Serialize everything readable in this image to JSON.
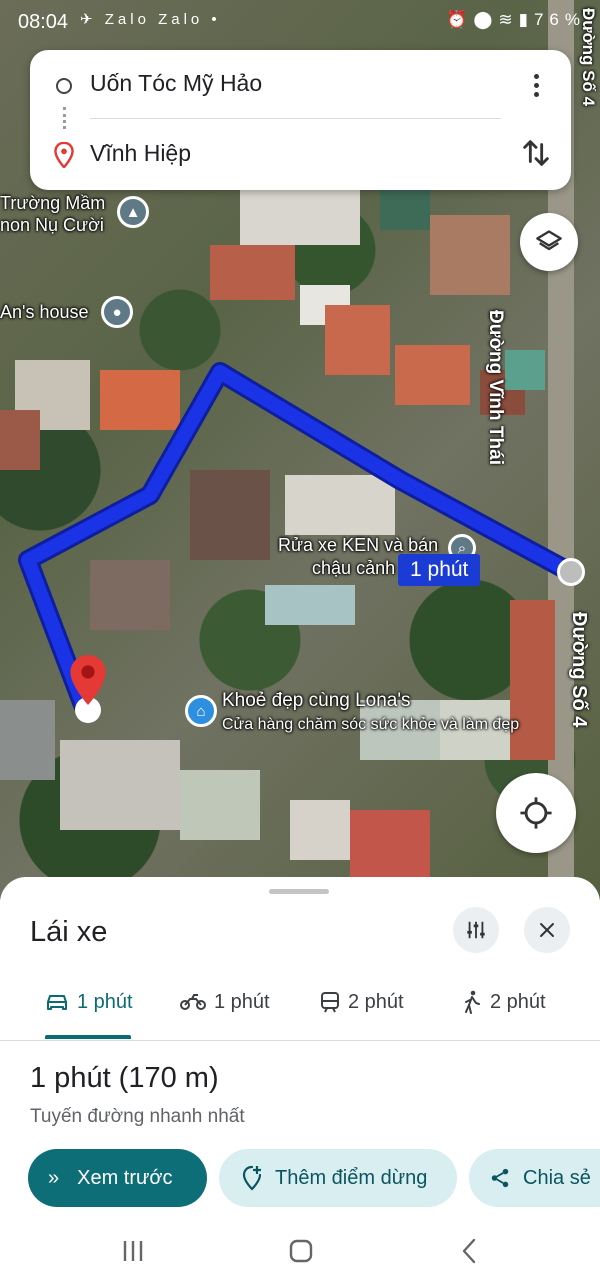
{
  "status_bar": {
    "time": "08:04",
    "left_icons": "✈ Zalo Zalo •",
    "battery": "76%"
  },
  "route_card": {
    "origin": "Uốn Tóc Mỹ Hảo",
    "destination": "Vĩnh Hiệp"
  },
  "map": {
    "labels": {
      "school": "Trường Mầm\nnon Nụ Cười",
      "ans_house": "An's house",
      "carwash": "Rửa xe KEN và bán\nchậu cảnh l",
      "lonas": "Khoẻ đẹp cùng Lona's",
      "lonas_sub": "Cửa hàng chăm sóc sức khỏe và làm đẹp",
      "street_vinh_thai": "Đường Vĩnh Thái",
      "street_so4_top": "Đường Số 4",
      "street_so4": "Đường Số 4"
    },
    "route_time_chip": "1 phút",
    "route_color": "#1a33e6"
  },
  "sheet": {
    "title": "Lái xe",
    "modes": [
      {
        "icon": "car-icon",
        "label": "1 phút",
        "active": true
      },
      {
        "icon": "motorbike-icon",
        "label": "1 phút",
        "active": false
      },
      {
        "icon": "transit-icon",
        "label": "2 phút",
        "active": false
      },
      {
        "icon": "walk-icon",
        "label": "2 phút",
        "active": false
      }
    ],
    "summary": "1 phút (170 m)",
    "subtitle": "Tuyến đường nhanh nhất",
    "buttons": {
      "preview": "Xem trước",
      "add_stop": "Thêm điểm dừng",
      "share": "Chia sẻ"
    }
  },
  "colors": {
    "accent": "#0d6e78",
    "accent_light": "#d9eef0",
    "pin_red": "#e53935"
  }
}
